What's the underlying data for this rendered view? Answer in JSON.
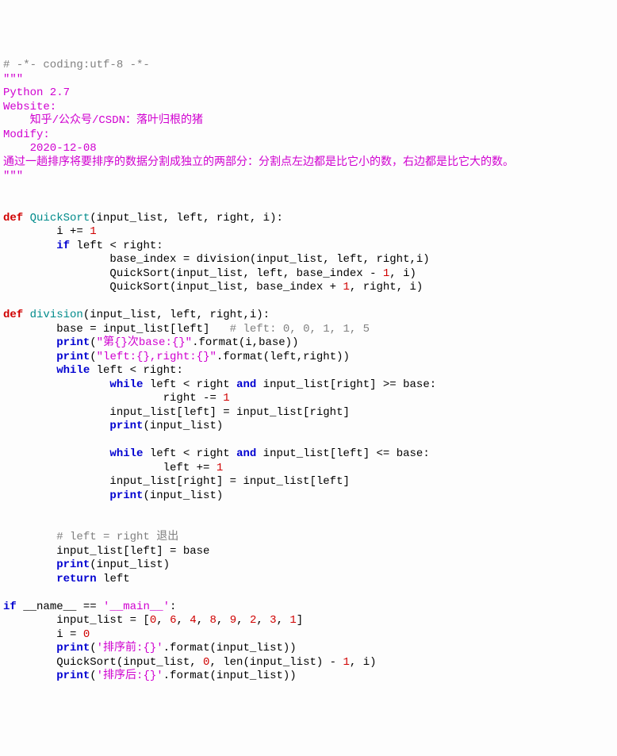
{
  "lines": [
    [
      {
        "cls": "c-comment",
        "t": "# -*- coding:utf-8 -*-"
      }
    ],
    [
      {
        "cls": "c-string",
        "t": "\"\"\""
      }
    ],
    [
      {
        "cls": "c-string",
        "t": "Python 2.7"
      }
    ],
    [
      {
        "cls": "c-string",
        "t": "Website:"
      }
    ],
    [
      {
        "cls": "c-string",
        "t": "    知乎/公众号/CSDN：落叶归根的猪"
      }
    ],
    [
      {
        "cls": "c-string",
        "t": "Modify:"
      }
    ],
    [
      {
        "cls": "c-string",
        "t": "    2020-12-08"
      }
    ],
    [
      {
        "cls": "c-string",
        "t": "通过一趟排序将要排序的数据分割成独立的两部分：分割点左边都是比它小的数，右边都是比它大的数。"
      }
    ],
    [
      {
        "cls": "c-string",
        "t": "\"\"\""
      }
    ],
    [
      {
        "cls": "",
        "t": ""
      }
    ],
    [
      {
        "cls": "",
        "t": ""
      }
    ],
    [
      {
        "cls": "c-def",
        "t": "def"
      },
      {
        "cls": "",
        "t": " "
      },
      {
        "cls": "c-func",
        "t": "QuickSort"
      },
      {
        "cls": "c-op",
        "t": "(input_list, left, right, i):"
      }
    ],
    [
      {
        "cls": "",
        "t": "        i += "
      },
      {
        "cls": "c-num",
        "t": "1"
      }
    ],
    [
      {
        "cls": "",
        "t": "        "
      },
      {
        "cls": "c-kw",
        "t": "if"
      },
      {
        "cls": "",
        "t": " left < right:"
      }
    ],
    [
      {
        "cls": "",
        "t": "                base_index = division(input_list, left, right,i)"
      }
    ],
    [
      {
        "cls": "",
        "t": "                QuickSort(input_list, left, base_index - "
      },
      {
        "cls": "c-num",
        "t": "1"
      },
      {
        "cls": "",
        "t": ", i)"
      }
    ],
    [
      {
        "cls": "",
        "t": "                QuickSort(input_list, base_index + "
      },
      {
        "cls": "c-num",
        "t": "1"
      },
      {
        "cls": "",
        "t": ", right, i)"
      }
    ],
    [
      {
        "cls": "",
        "t": ""
      }
    ],
    [
      {
        "cls": "c-def",
        "t": "def"
      },
      {
        "cls": "",
        "t": " "
      },
      {
        "cls": "c-func",
        "t": "division"
      },
      {
        "cls": "c-op",
        "t": "(input_list, left, right,i):"
      }
    ],
    [
      {
        "cls": "",
        "t": "        base = input_list[left]   "
      },
      {
        "cls": "c-comment",
        "t": "# left: 0, 0, 1, 1, 5"
      }
    ],
    [
      {
        "cls": "",
        "t": "        "
      },
      {
        "cls": "c-kw",
        "t": "print"
      },
      {
        "cls": "",
        "t": "("
      },
      {
        "cls": "c-string",
        "t": "\"第{}次base:{}\""
      },
      {
        "cls": "",
        "t": ".format(i,base))"
      }
    ],
    [
      {
        "cls": "",
        "t": "        "
      },
      {
        "cls": "c-kw",
        "t": "print"
      },
      {
        "cls": "",
        "t": "("
      },
      {
        "cls": "c-string",
        "t": "\"left:{},right:{}\""
      },
      {
        "cls": "",
        "t": ".format(left,right))"
      }
    ],
    [
      {
        "cls": "",
        "t": "        "
      },
      {
        "cls": "c-kw",
        "t": "while"
      },
      {
        "cls": "",
        "t": " left < right:"
      }
    ],
    [
      {
        "cls": "",
        "t": "                "
      },
      {
        "cls": "c-kw",
        "t": "while"
      },
      {
        "cls": "",
        "t": " left < right "
      },
      {
        "cls": "c-kw",
        "t": "and"
      },
      {
        "cls": "",
        "t": " input_list[right] >= base:"
      }
    ],
    [
      {
        "cls": "",
        "t": "                        right -= "
      },
      {
        "cls": "c-num",
        "t": "1"
      }
    ],
    [
      {
        "cls": "",
        "t": "                input_list[left] = input_list[right]"
      }
    ],
    [
      {
        "cls": "",
        "t": "                "
      },
      {
        "cls": "c-kw",
        "t": "print"
      },
      {
        "cls": "",
        "t": "(input_list)"
      }
    ],
    [
      {
        "cls": "",
        "t": ""
      }
    ],
    [
      {
        "cls": "",
        "t": "                "
      },
      {
        "cls": "c-kw",
        "t": "while"
      },
      {
        "cls": "",
        "t": " left < right "
      },
      {
        "cls": "c-kw",
        "t": "and"
      },
      {
        "cls": "",
        "t": " input_list[left] <= base:"
      }
    ],
    [
      {
        "cls": "",
        "t": "                        left += "
      },
      {
        "cls": "c-num",
        "t": "1"
      }
    ],
    [
      {
        "cls": "",
        "t": "                input_list[right] = input_list[left]"
      }
    ],
    [
      {
        "cls": "",
        "t": "                "
      },
      {
        "cls": "c-kw",
        "t": "print"
      },
      {
        "cls": "",
        "t": "(input_list)"
      }
    ],
    [
      {
        "cls": "",
        "t": ""
      }
    ],
    [
      {
        "cls": "",
        "t": ""
      }
    ],
    [
      {
        "cls": "",
        "t": "        "
      },
      {
        "cls": "c-comment",
        "t": "# left = right 退出"
      }
    ],
    [
      {
        "cls": "",
        "t": "        input_list[left] = base"
      }
    ],
    [
      {
        "cls": "",
        "t": "        "
      },
      {
        "cls": "c-kw",
        "t": "print"
      },
      {
        "cls": "",
        "t": "(input_list)"
      }
    ],
    [
      {
        "cls": "",
        "t": "        "
      },
      {
        "cls": "c-kw",
        "t": "return"
      },
      {
        "cls": "",
        "t": " left"
      }
    ],
    [
      {
        "cls": "",
        "t": ""
      }
    ],
    [
      {
        "cls": "c-kw",
        "t": "if"
      },
      {
        "cls": "",
        "t": " __name__ == "
      },
      {
        "cls": "c-string",
        "t": "'__main__'"
      },
      {
        "cls": "",
        "t": ":"
      }
    ],
    [
      {
        "cls": "",
        "t": "        input_list = ["
      },
      {
        "cls": "c-num",
        "t": "0"
      },
      {
        "cls": "",
        "t": ", "
      },
      {
        "cls": "c-num",
        "t": "6"
      },
      {
        "cls": "",
        "t": ", "
      },
      {
        "cls": "c-num",
        "t": "4"
      },
      {
        "cls": "",
        "t": ", "
      },
      {
        "cls": "c-num",
        "t": "8"
      },
      {
        "cls": "",
        "t": ", "
      },
      {
        "cls": "c-num",
        "t": "9"
      },
      {
        "cls": "",
        "t": ", "
      },
      {
        "cls": "c-num",
        "t": "2"
      },
      {
        "cls": "",
        "t": ", "
      },
      {
        "cls": "c-num",
        "t": "3"
      },
      {
        "cls": "",
        "t": ", "
      },
      {
        "cls": "c-num",
        "t": "1"
      },
      {
        "cls": "",
        "t": "]"
      }
    ],
    [
      {
        "cls": "",
        "t": "        i = "
      },
      {
        "cls": "c-num",
        "t": "0"
      }
    ],
    [
      {
        "cls": "",
        "t": "        "
      },
      {
        "cls": "c-kw",
        "t": "print"
      },
      {
        "cls": "",
        "t": "("
      },
      {
        "cls": "c-string",
        "t": "'排序前:{}'"
      },
      {
        "cls": "",
        "t": ".format(input_list))"
      }
    ],
    [
      {
        "cls": "",
        "t": "        QuickSort(input_list, "
      },
      {
        "cls": "c-num",
        "t": "0"
      },
      {
        "cls": "",
        "t": ", len(input_list) - "
      },
      {
        "cls": "c-num",
        "t": "1"
      },
      {
        "cls": "",
        "t": ", i)"
      }
    ],
    [
      {
        "cls": "",
        "t": "        "
      },
      {
        "cls": "c-kw",
        "t": "print"
      },
      {
        "cls": "",
        "t": "("
      },
      {
        "cls": "c-string",
        "t": "'排序后:{}'"
      },
      {
        "cls": "",
        "t": ".format(input_list))"
      }
    ]
  ]
}
